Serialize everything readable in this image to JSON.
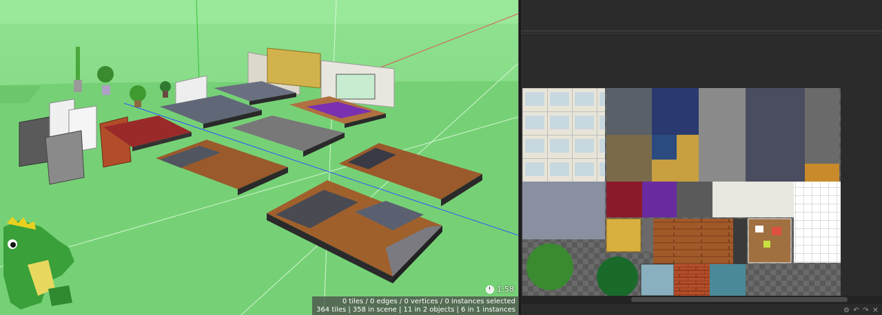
{
  "viewport": {
    "timer": "1:58",
    "status_line_1": "0 tiles / 0 edges / 0 vertices / 0 instances selected",
    "status_line_2": "364 tiles | 358 in scene | 11 in 2 objects | 6 in 1 instances",
    "background_color": "#8ee08e",
    "axis_x_color": "#e05050",
    "axis_y_color": "#30c030",
    "axis_z_color": "#3050ff"
  },
  "tileset_panel": {
    "toolbar": {
      "icon_1": "settings-icon",
      "icon_2": "undo-icon",
      "icon_3": "redo-icon",
      "icon_4": "delete-icon"
    }
  },
  "icons": {
    "timer": "clock-icon"
  }
}
